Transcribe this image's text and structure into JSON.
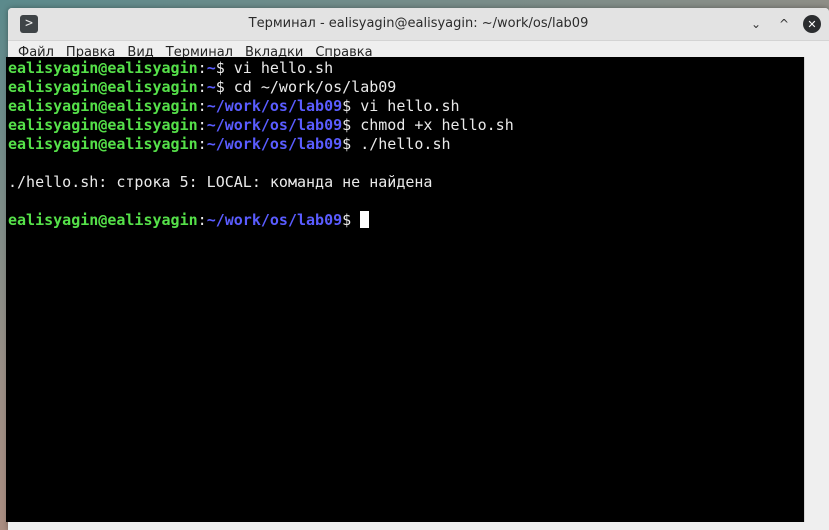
{
  "window": {
    "title": "Терминал - ealisyagin@ealisyagin: ~/work/os/lab09",
    "app_icon": ">",
    "buttons": {
      "minimize": "⌄",
      "maximize": "^",
      "close": "✕"
    }
  },
  "menu": {
    "items": [
      "Файл",
      "Правка",
      "Вид",
      "Терминал",
      "Вкладки",
      "Справка"
    ]
  },
  "terminal": {
    "lines": [
      {
        "user": "ealisyagin@ealisyagin",
        "sep": ":",
        "path": "~",
        "prompt": "$ ",
        "cmd": "vi hello.sh"
      },
      {
        "user": "ealisyagin@ealisyagin",
        "sep": ":",
        "path": "~",
        "prompt": "$ ",
        "cmd": "cd ~/work/os/lab09"
      },
      {
        "user": "ealisyagin@ealisyagin",
        "sep": ":",
        "path": "~/work/os/lab09",
        "prompt": "$ ",
        "cmd": "vi hello.sh"
      },
      {
        "user": "ealisyagin@ealisyagin",
        "sep": ":",
        "path": "~/work/os/lab09",
        "prompt": "$ ",
        "cmd": "chmod +x hello.sh"
      },
      {
        "user": "ealisyagin@ealisyagin",
        "sep": ":",
        "path": "~/work/os/lab09",
        "prompt": "$ ",
        "cmd": "./hello.sh"
      }
    ],
    "output": "./hello.sh: строка 5: LOCAL: команда не найдена",
    "current_prompt": {
      "user": "ealisyagin@ealisyagin",
      "sep": ":",
      "path": "~/work/os/lab09",
      "prompt": "$ "
    }
  },
  "colors": {
    "user": "#55e049",
    "path": "#5a5cff",
    "background": "#000000",
    "text": "#eaeaea"
  }
}
